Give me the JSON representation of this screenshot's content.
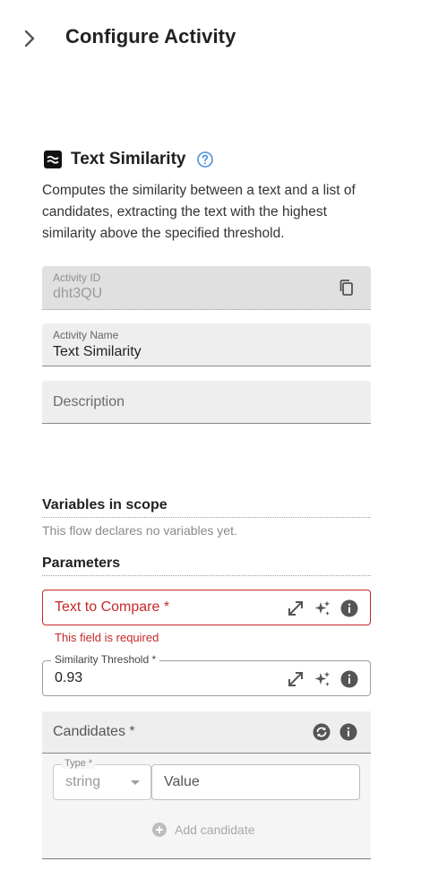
{
  "header": {
    "title": "Configure Activity"
  },
  "activity": {
    "title": "Text Similarity",
    "description": "Computes the similarity between a text and a list of candidates, extracting the text with the highest similarity above the specified threshold."
  },
  "fields": {
    "activity_id": {
      "label": "Activity ID",
      "value": "dht3QU"
    },
    "activity_name": {
      "label": "Activity Name",
      "value": "Text Similarity"
    },
    "description": {
      "placeholder": "Description"
    }
  },
  "variables": {
    "title": "Variables in scope",
    "empty_text": "This flow declares no variables yet."
  },
  "parameters": {
    "title": "Parameters",
    "text_to_compare": {
      "label": "Text to Compare *",
      "error": "This field is required"
    },
    "similarity_threshold": {
      "label": "Similarity Threshold *",
      "value": "0.93"
    },
    "candidates": {
      "label": "Candidates *",
      "type_label": "Type *",
      "type_value": "string",
      "value_placeholder": "Value",
      "add_label": "Add candidate"
    }
  },
  "colors": {
    "error": "#c62828",
    "help_accent": "#4a90d9",
    "field_bg": "#eeeeee"
  }
}
